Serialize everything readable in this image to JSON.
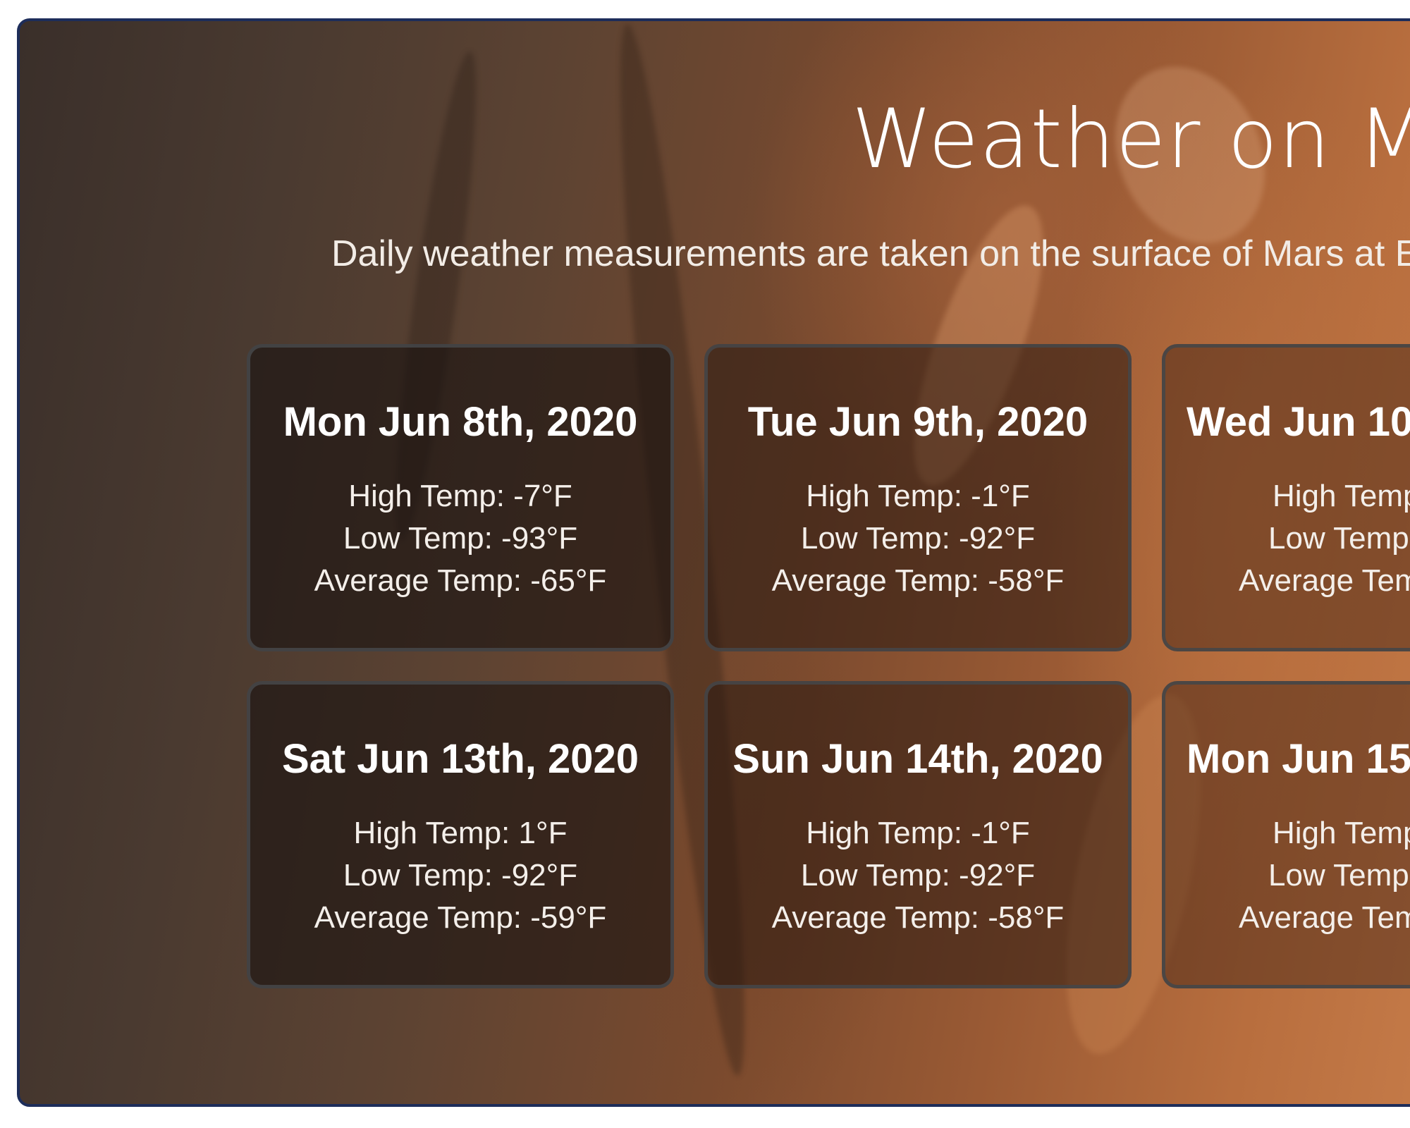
{
  "page": {
    "title": "Weather on Ma",
    "subtitle": "Daily weather measurements are taken on the surface of Mars at E"
  },
  "colors": {
    "frame_border": "#1d2d5a",
    "text": "#ffffff",
    "card_border": "#464648"
  },
  "cards": [
    {
      "date": "Mon Jun 8th, 2020",
      "high": "High Temp: -7°F",
      "low": "Low Temp: -93°F",
      "avg": "Average Temp: -65°F"
    },
    {
      "date": "Tue Jun 9th, 2020",
      "high": "High Temp: -1°F",
      "low": "Low Temp: -92°F",
      "avg": "Average Temp: -58°F"
    },
    {
      "date": "Wed Jun 10",
      "high": "High Temp",
      "low": "Low Temp",
      "avg": "Average Tem"
    },
    {
      "date": "Sat Jun 13th, 2020",
      "high": "High Temp: 1°F",
      "low": "Low Temp: -92°F",
      "avg": "Average Temp: -59°F"
    },
    {
      "date": "Sun Jun 14th, 2020",
      "high": "High Temp: -1°F",
      "low": "Low Temp: -92°F",
      "avg": "Average Temp: -58°F"
    },
    {
      "date": "Mon Jun 15",
      "high": "High Temp",
      "low": "Low Temp",
      "avg": "Average Tem"
    }
  ]
}
